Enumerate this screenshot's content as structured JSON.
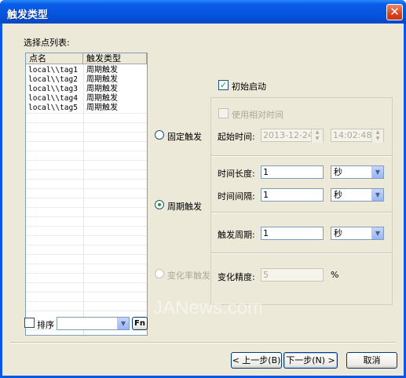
{
  "window": {
    "title": "触发类型",
    "close_glyph": "✕"
  },
  "points_list": {
    "label": "选择点列表:",
    "columns": [
      "点名",
      "触发类型"
    ],
    "rows": [
      {
        "name": "local\\\\tag1",
        "type": "周期触发"
      },
      {
        "name": "local\\\\tag2",
        "type": "周期触发"
      },
      {
        "name": "local\\\\tag3",
        "type": "周期触发"
      },
      {
        "name": "local\\\\tag4",
        "type": "周期触发"
      },
      {
        "name": "local\\\\tag5",
        "type": "周期触发"
      }
    ]
  },
  "sort": {
    "label": "排序",
    "checked": false,
    "value": "",
    "fn_label": "Fn"
  },
  "initial_start": {
    "label": "初始启动",
    "checked": true
  },
  "fixed_trigger": {
    "label": "固定触发",
    "selected": false,
    "use_relative_label": "使用相对时间",
    "start_time_label": "起始时间:",
    "date_value": "2013-12-24",
    "time_value": "14:02:48"
  },
  "periodic_trigger": {
    "label": "周期触发",
    "selected": true,
    "duration_label": "时间长度:",
    "duration_value": "1",
    "duration_unit": "秒",
    "interval_label": "时间间隔:",
    "interval_value": "1",
    "interval_unit": "秒",
    "period_label": "触发周期:",
    "period_value": "1",
    "period_unit": "秒"
  },
  "change_rate_trigger": {
    "label": "变化率触发",
    "selected": false,
    "precision_label": "变化精度:",
    "precision_value": "5",
    "precision_unit": "%"
  },
  "buttons": {
    "prev": "< 上一步(B)",
    "next": "下一步(N) >",
    "cancel": "取消"
  },
  "watermark": "JANews.com"
}
